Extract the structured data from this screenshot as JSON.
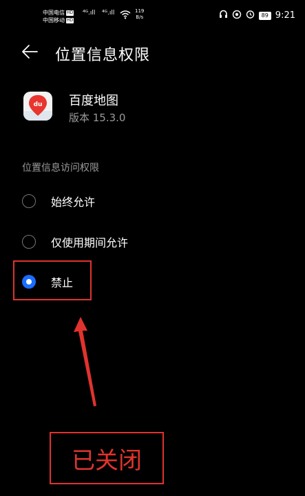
{
  "status": {
    "carrier1": "中国电信",
    "carrier2": "中国移动",
    "hd": "HD",
    "signal1": "⁴ᴳ.ıll",
    "signal2": "⁴ᴳ.ıll",
    "speed_value": "119",
    "speed_unit": "B/s",
    "battery": "89",
    "time": "9:21"
  },
  "header": {
    "title": "位置信息权限"
  },
  "app": {
    "name": "百度地图",
    "version": "版本 15.3.0",
    "icon_text": "du"
  },
  "section_title": "位置信息访问权限",
  "options": [
    {
      "label": "始终允许",
      "selected": false
    },
    {
      "label": "仅使用期间允许",
      "selected": false
    },
    {
      "label": "禁止",
      "selected": true
    }
  ],
  "annotation": {
    "text": "已关闭",
    "color": "#e0332d"
  },
  "colors": {
    "accent": "#1a6dff",
    "annotation": "#e0332d"
  }
}
